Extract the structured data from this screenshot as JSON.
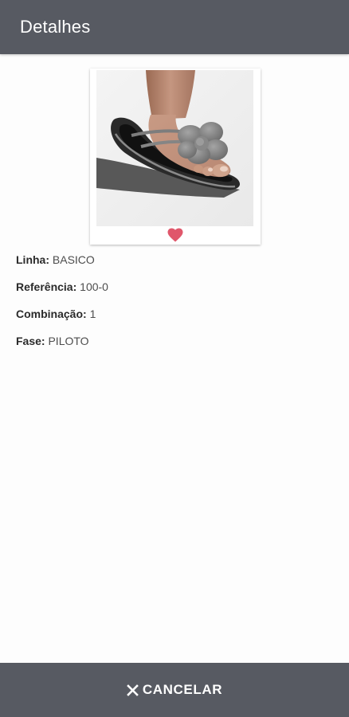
{
  "appbar": {
    "title": "Detalhes"
  },
  "product": {
    "image_alt": "Sandália com flor",
    "favorite_icon": "heart-icon",
    "favorite_color": "#e0576b"
  },
  "details": [
    {
      "label": "Linha:",
      "value": "BASICO"
    },
    {
      "label": "Referência:",
      "value": "100-0"
    },
    {
      "label": "Combinação:",
      "value": "1"
    },
    {
      "label": "Fase:",
      "value": "PILOTO"
    }
  ],
  "footer": {
    "cancel_label": "CANCELAR",
    "cancel_icon": "close-icon"
  },
  "colors": {
    "bar": "#575a62",
    "bar_text": "#ffffff",
    "background": "#fdfdfd"
  }
}
